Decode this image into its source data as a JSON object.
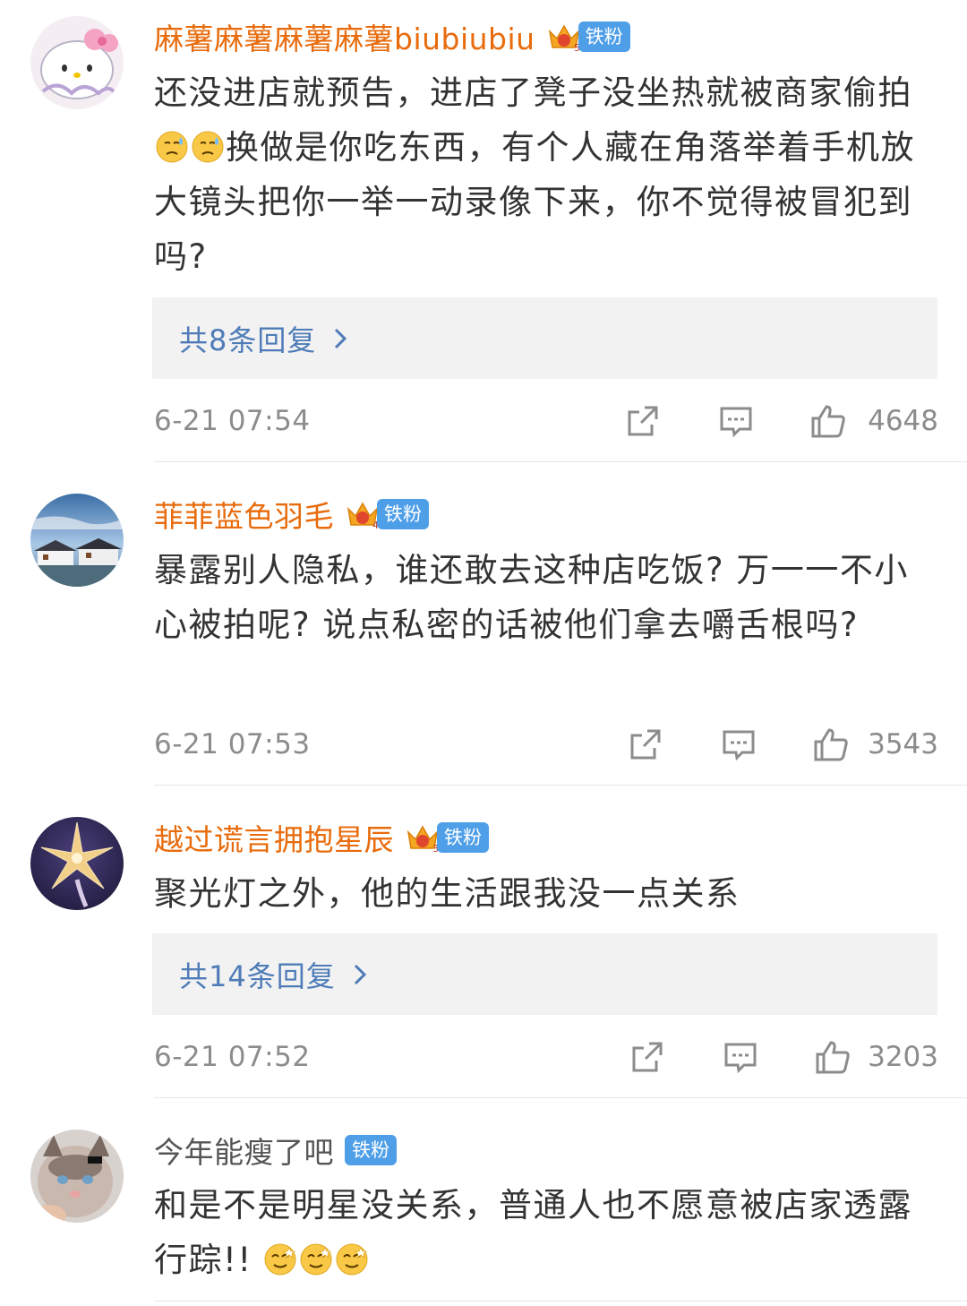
{
  "comments": [
    {
      "username": "麻薯麻薯麻薯麻薯biubiubiu",
      "fan_level": "5",
      "fan_badge": "铁粉",
      "text_parts": [
        "还没进店就预告，进店了凳子没坐热就被商家偷拍",
        "换做是你吃东西，有个人藏在角落举着手机放大镜头把你一举一动录像下来，你不觉得被冒犯到吗?"
      ],
      "inline_emojis": [
        "sweat-emoji",
        "sweat-emoji"
      ],
      "replies_label": "共8条回复",
      "timestamp": "6-21 07:54",
      "likes": "4648"
    },
    {
      "username": "菲菲蓝色羽毛",
      "fan_level": "4",
      "fan_badge": "铁粉",
      "text": "暴露别人隐私，谁还敢去这种店吃饭? 万一一不小心被拍呢? 说点私密的话被他们拿去嚼舌根吗?",
      "timestamp": "6-21 07:53",
      "likes": "3543"
    },
    {
      "username": "越过谎言拥抱星辰",
      "fan_level": "3",
      "fan_badge": "铁粉",
      "text": "聚光灯之外，他的生活跟我没一点关系",
      "replies_label": "共14条回复",
      "timestamp": "6-21 07:52",
      "likes": "3203"
    },
    {
      "username": "今年能瘦了吧",
      "fan_badge": "铁粉",
      "text": "和是不是明星没关系，普通人也不愿意被店家透露行踪!!",
      "inline_emojis": [
        "smirk-emoji",
        "smirk-emoji",
        "smirk-emoji"
      ]
    }
  ],
  "icons": {
    "share": "share-icon",
    "comment": "comment-icon",
    "like": "thumbs-up-icon",
    "chevron": "chevron-right-icon",
    "crown": "crown-icon"
  },
  "colors": {
    "username": "#e86b0c",
    "badge": "#4f9fe8",
    "replies_link": "#4f7cb8",
    "meta": "#8c8c8c"
  }
}
